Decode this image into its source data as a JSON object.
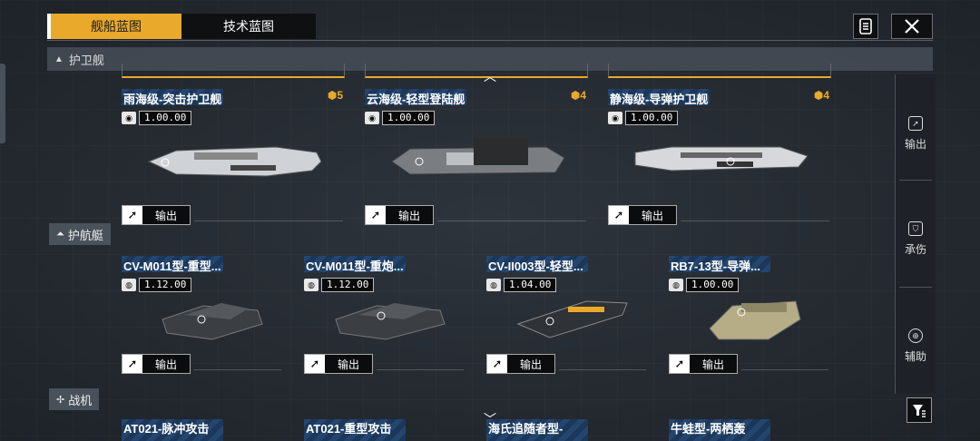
{
  "tabs": [
    {
      "label": "舰船蓝图",
      "active": true
    },
    {
      "label": "技术蓝图",
      "active": false
    }
  ],
  "sections": {
    "frigate": "护卫舰",
    "escort": "护航艇",
    "fighter": "战机"
  },
  "frigates": [
    {
      "title": "雨海级-突击护卫舰",
      "level": "5",
      "value": "1.00.00",
      "stat_icon": "ship-hull-icon",
      "export": "输出"
    },
    {
      "title": "云海级-轻型登陆舰",
      "level": "4",
      "value": "1.00.00",
      "stat_icon": "ship-hull-icon",
      "export": "输出"
    },
    {
      "title": "静海级-导弹护卫舰",
      "level": "4",
      "value": "1.00.00",
      "stat_icon": "ship-hull-icon",
      "export": "输出"
    }
  ],
  "escorts": [
    {
      "title": "CV-M011型-重型...",
      "value": "1.12.00",
      "stat_icon": "globe-icon",
      "export": "输出"
    },
    {
      "title": "CV-M011型-重炮...",
      "value": "1.12.00",
      "stat_icon": "globe-icon",
      "export": "输出"
    },
    {
      "title": "CV-II003型-轻型...",
      "value": "1.04.00",
      "stat_icon": "globe-icon",
      "export": "输出"
    },
    {
      "title": "RB7-13型-导弹...",
      "value": "1.00.00",
      "stat_icon": "globe-icon",
      "export": "输出"
    }
  ],
  "fighters_partial": [
    "AT021-脉冲攻击",
    "AT021-重型攻击",
    "海氏追随者型-",
    "牛蛙型-两栖轰"
  ],
  "right_panel": [
    {
      "label": "输出",
      "icon": "export-icon"
    },
    {
      "label": "承伤",
      "icon": "shield-icon"
    },
    {
      "label": "辅助",
      "icon": "support-icon"
    }
  ],
  "colors": {
    "accent": "#e9a92a",
    "title_stripe": "#24456e",
    "background": "#2a3037"
  }
}
